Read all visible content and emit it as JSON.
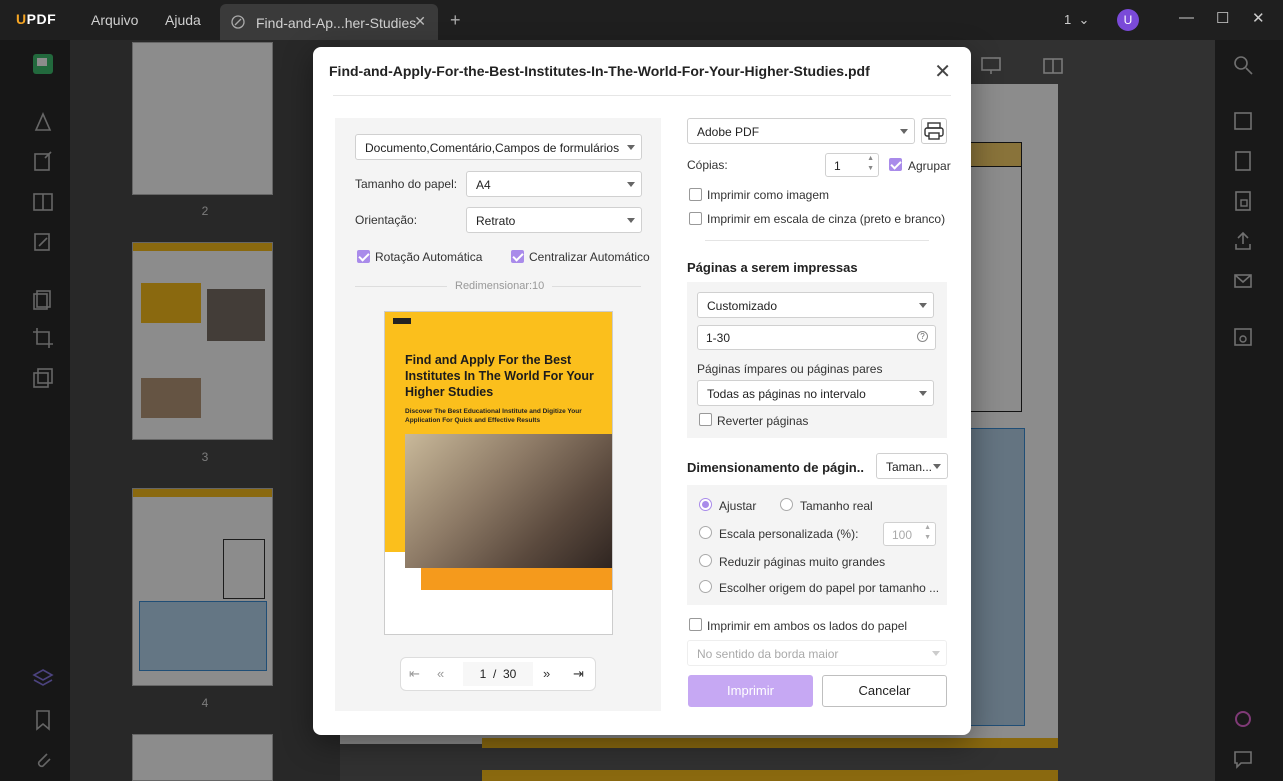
{
  "app": {
    "logo": "UPDF",
    "menu": [
      "Arquivo",
      "Ajuda"
    ],
    "tab_title": "Find-and-Ap...her-Studies",
    "page_indicator": "1",
    "avatar_letter": "U"
  },
  "thumbnails": [
    {
      "page": "2"
    },
    {
      "page": "3"
    },
    {
      "page": "4"
    }
  ],
  "dialog": {
    "title": "Find-and-Apply-For-the-Best-Institutes-In-The-World-For-Your-Higher-Studies.pdf",
    "left": {
      "content_select": "Documento,Comentário,Campos de formulários",
      "paper_size_label": "Tamanho do papel:",
      "paper_size": "A4",
      "orientation_label": "Orientação:",
      "orientation": "Retrato",
      "auto_rotate_label": "Rotação Automática",
      "auto_rotate": true,
      "auto_center_label": "Centralizar Automático",
      "auto_center": true,
      "resize_label": "Redimensionar:10",
      "preview": {
        "logo": "UPDF",
        "title": "Find and Apply For the Best Institutes In The World For Your Higher Studies",
        "subtitle": "Discover The Best Educational Institute and Digitize Your Application For Quick and Effective Results"
      },
      "pager": {
        "current": "1",
        "separator": "/",
        "total": "30"
      }
    },
    "right": {
      "printer": "Adobe PDF",
      "copies_label": "Cópias:",
      "copies": "1",
      "collate_label": "Agrupar",
      "collate": true,
      "print_as_image_label": "Imprimir como imagem",
      "print_as_image": false,
      "grayscale_label": "Imprimir em escala de cinza (preto e branco)",
      "grayscale": false,
      "pages_section": "Páginas a serem impressas",
      "range_mode": "Customizado",
      "range_value": "1-30",
      "odd_even_label": "Páginas ímpares ou páginas pares",
      "odd_even": "Todas as páginas no intervalo",
      "reverse_label": "Reverter páginas",
      "reverse": false,
      "sizing_section": "Dimensionamento de págin..",
      "sizing_select": "Taman...",
      "fit_label": "Ajustar",
      "actual_label": "Tamanho real",
      "custom_scale_label": "Escala personalizada (%):",
      "custom_scale_value": "100",
      "shrink_label": "Reduzir páginas muito grandes",
      "choose_source_label": "Escolher origem do papel por tamanho ...",
      "selected_sizing": "Ajustar",
      "duplex_label": "Imprimir em ambos os lados do papel",
      "duplex": false,
      "duplex_edge": "No sentido da borda maior",
      "print_button": "Imprimir",
      "cancel_button": "Cancelar"
    }
  },
  "colors": {
    "accent": "#a98bea",
    "primary_button": "#c6a8f3",
    "brand_yellow": "#fbbf1c"
  }
}
